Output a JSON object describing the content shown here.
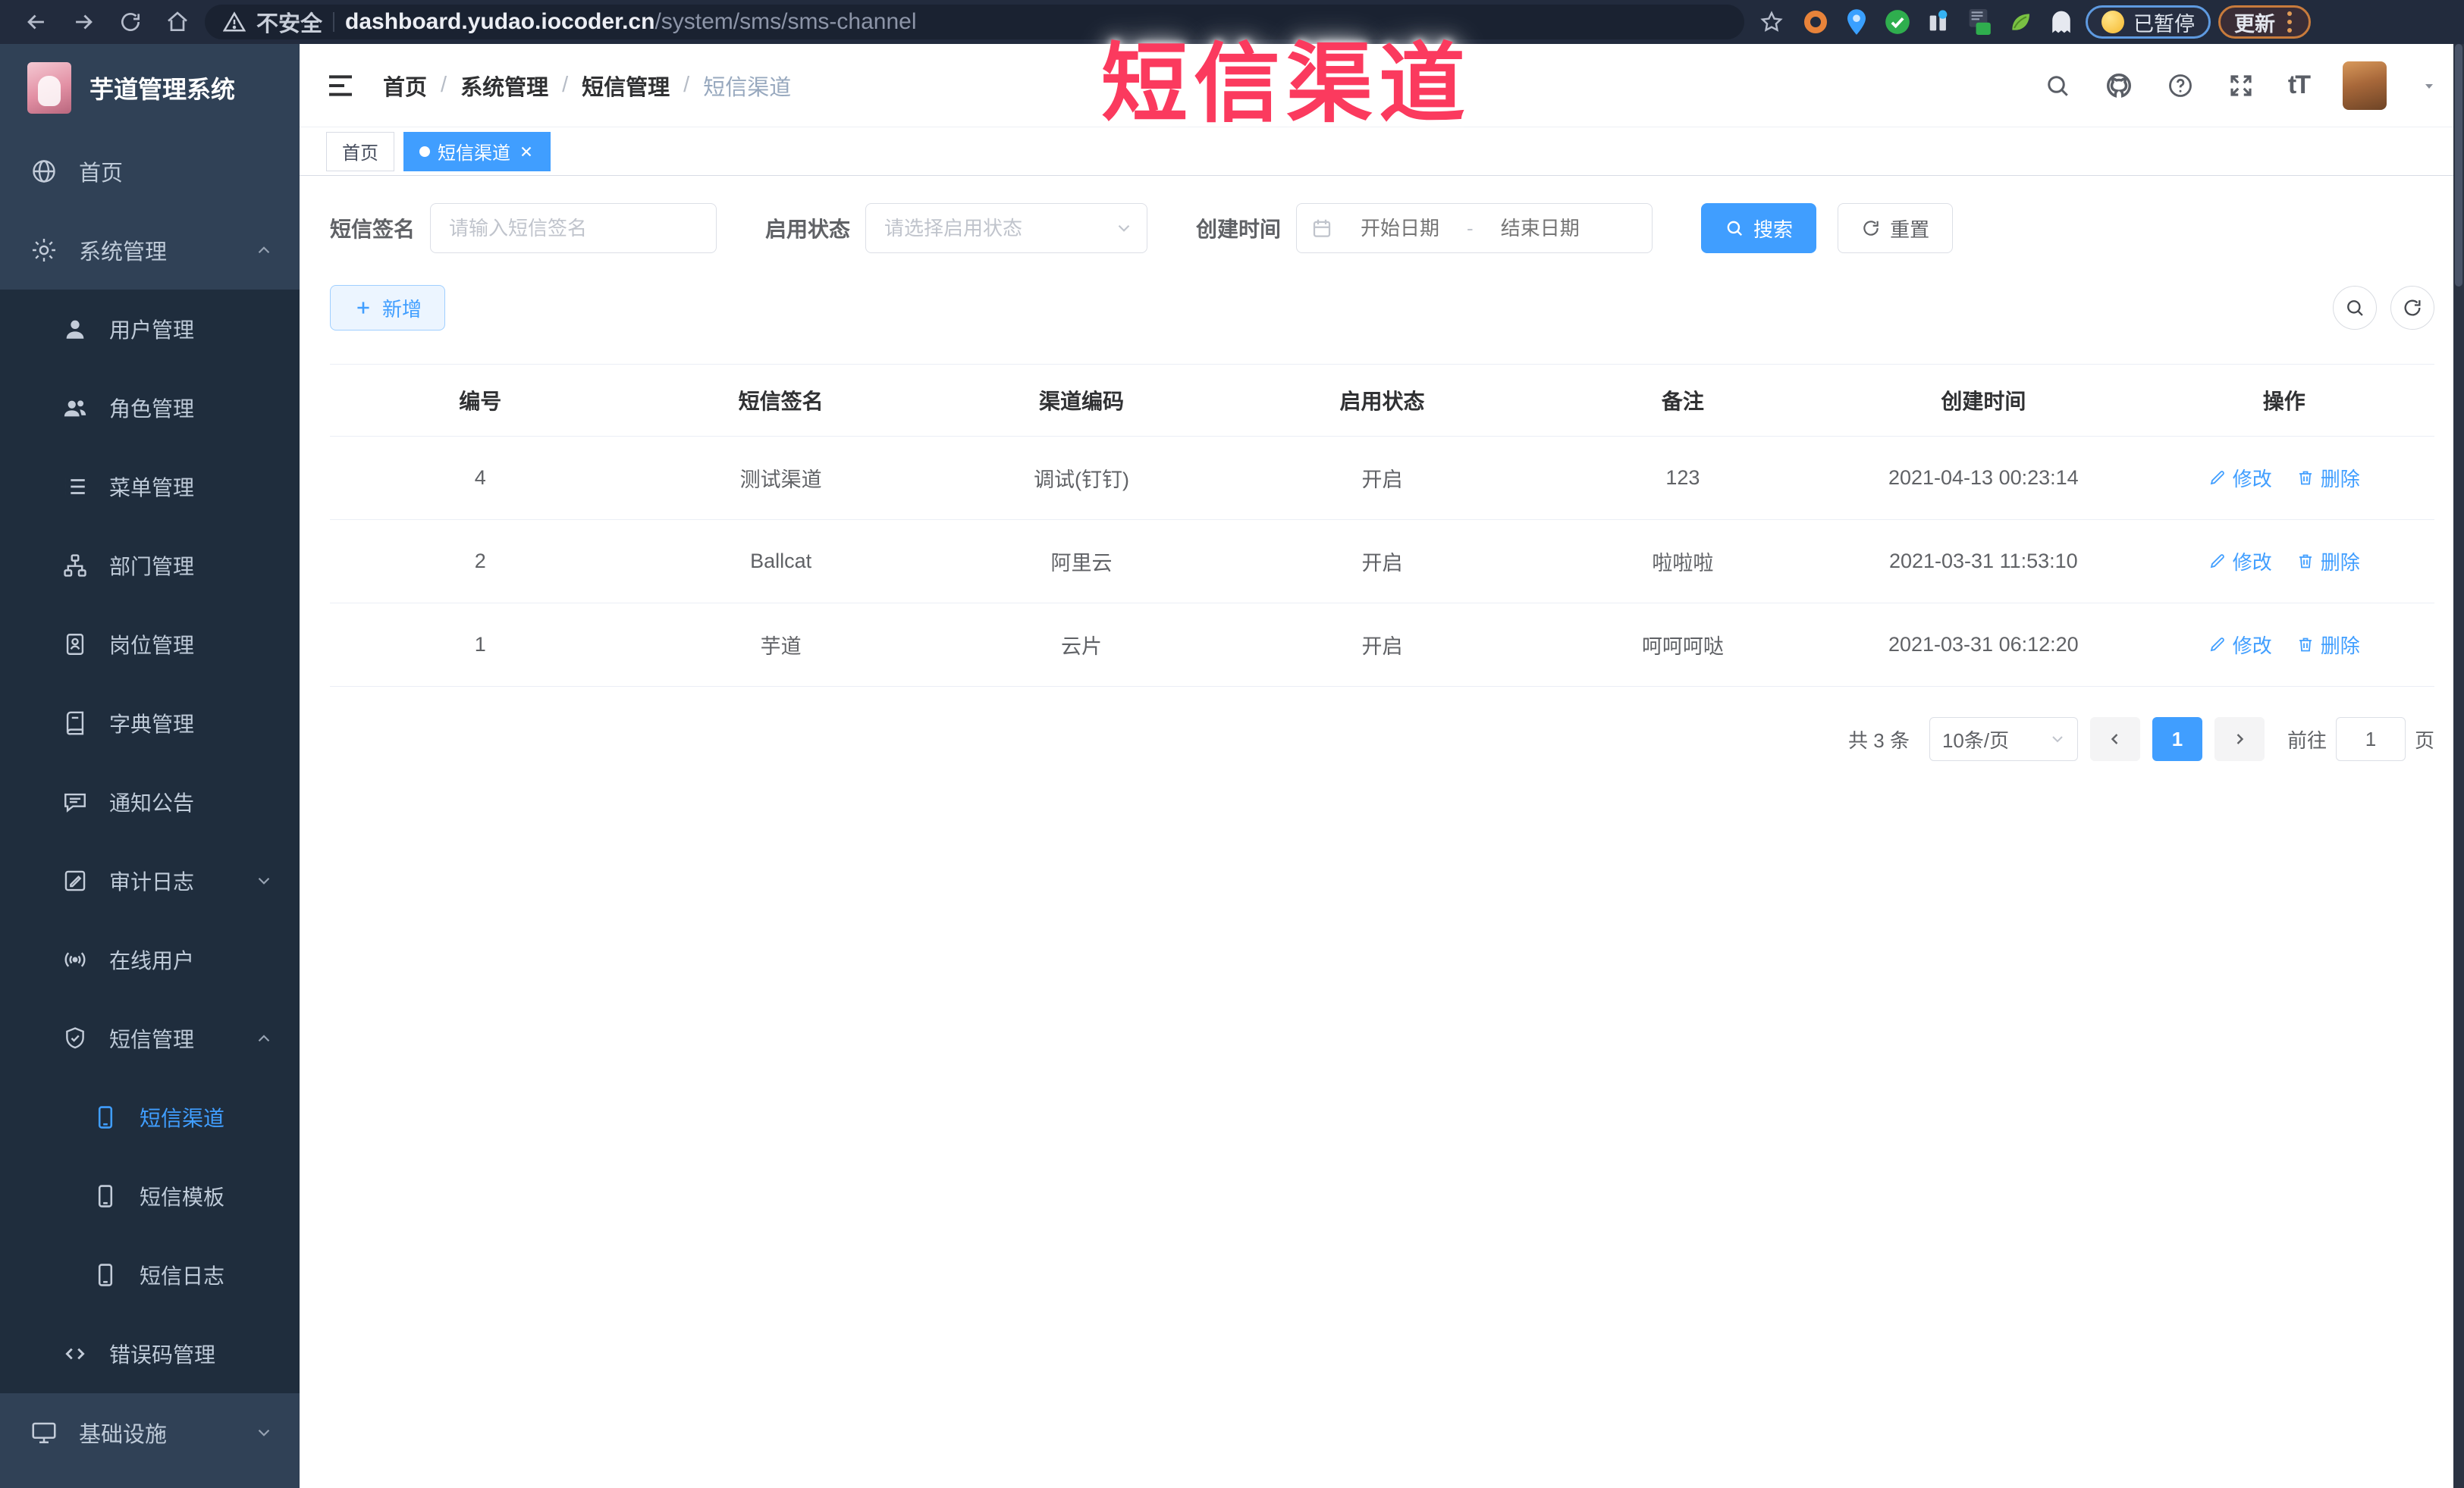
{
  "browser": {
    "security_label": "不安全",
    "url_domain": "dashboard.yudao.iocoder.cn",
    "url_path": "/system/sms/sms-channel",
    "paused_badge_label": "已暂停",
    "update_button_label": "更新"
  },
  "watermark_text": "短信渠道",
  "sidebar": {
    "logo_title": "芋道管理系统",
    "menu": [
      {
        "label": "首页",
        "icon": "globe-icon",
        "level": 1
      },
      {
        "label": "系统管理",
        "icon": "gear-icon",
        "level": 1,
        "expanded": true
      },
      {
        "label": "用户管理",
        "icon": "user-icon",
        "level": 2
      },
      {
        "label": "角色管理",
        "icon": "users-icon",
        "level": 2
      },
      {
        "label": "菜单管理",
        "icon": "menu-list-icon",
        "level": 2
      },
      {
        "label": "部门管理",
        "icon": "org-tree-icon",
        "level": 2
      },
      {
        "label": "岗位管理",
        "icon": "id-badge-icon",
        "level": 2
      },
      {
        "label": "字典管理",
        "icon": "dictionary-icon",
        "level": 2
      },
      {
        "label": "通知公告",
        "icon": "announcement-icon",
        "level": 2
      },
      {
        "label": "审计日志",
        "icon": "audit-log-icon",
        "level": 2,
        "expanded": false
      },
      {
        "label": "在线用户",
        "icon": "broadcast-icon",
        "level": 2
      },
      {
        "label": "短信管理",
        "icon": "shield-check-icon",
        "level": 2,
        "expanded": true
      },
      {
        "label": "短信渠道",
        "icon": "phone-icon",
        "level": 3,
        "active": true
      },
      {
        "label": "短信模板",
        "icon": "phone-icon",
        "level": 3
      },
      {
        "label": "短信日志",
        "icon": "phone-icon",
        "level": 3
      },
      {
        "label": "错误码管理",
        "icon": "code-icon",
        "level": 2
      },
      {
        "label": "基础设施",
        "icon": "monitor-icon",
        "level": 1,
        "expanded": false
      }
    ]
  },
  "breadcrumb": {
    "items": [
      "首页",
      "系统管理",
      "短信管理",
      "短信渠道"
    ],
    "separator": "/"
  },
  "tabs": [
    {
      "label": "首页"
    },
    {
      "label": "短信渠道",
      "active": true,
      "closable": true
    }
  ],
  "filters": {
    "sign_label": "短信签名",
    "sign_placeholder": "请输入短信签名",
    "status_label": "启用状态",
    "status_placeholder": "请选择启用状态",
    "time_label": "创建时间",
    "start_placeholder": "开始日期",
    "range_separator": "-",
    "search_label": "搜索",
    "end_placeholder": "结束日期",
    "reset_label": "重置"
  },
  "toolbar": {
    "add_label": "新增"
  },
  "table": {
    "headers": [
      "编号",
      "短信签名",
      "渠道编码",
      "启用状态",
      "备注",
      "创建时间",
      "操作"
    ],
    "edit_label": "修改",
    "delete_label": "删除",
    "rows": [
      {
        "id": "4",
        "sign": "测试渠道",
        "code": "调试(钉钉)",
        "status": "开启",
        "remark": "123",
        "created": "2021-04-13 00:23:14"
      },
      {
        "id": "2",
        "sign": "Ballcat",
        "code": "阿里云",
        "status": "开启",
        "remark": "啦啦啦",
        "created": "2021-03-31 11:53:10"
      },
      {
        "id": "1",
        "sign": "芋道",
        "code": "云片",
        "status": "开启",
        "remark": "呵呵呵哒",
        "created": "2021-03-31 06:12:20"
      }
    ]
  },
  "pagination": {
    "total_label": "共 3 条",
    "page_size_value": "10条/页",
    "current_page": "1",
    "goto_label": "前往",
    "goto_value": "1",
    "page_unit_label": "页"
  },
  "colors": {
    "accent_blue": "#409eff",
    "sidebar_bg": "#304156",
    "sidebar_submenu_bg": "#1f2d3d",
    "active_tab_bg": "#409eff",
    "watermark_red": "#fb3a5e",
    "browser_chrome_bg": "#222b3d"
  }
}
